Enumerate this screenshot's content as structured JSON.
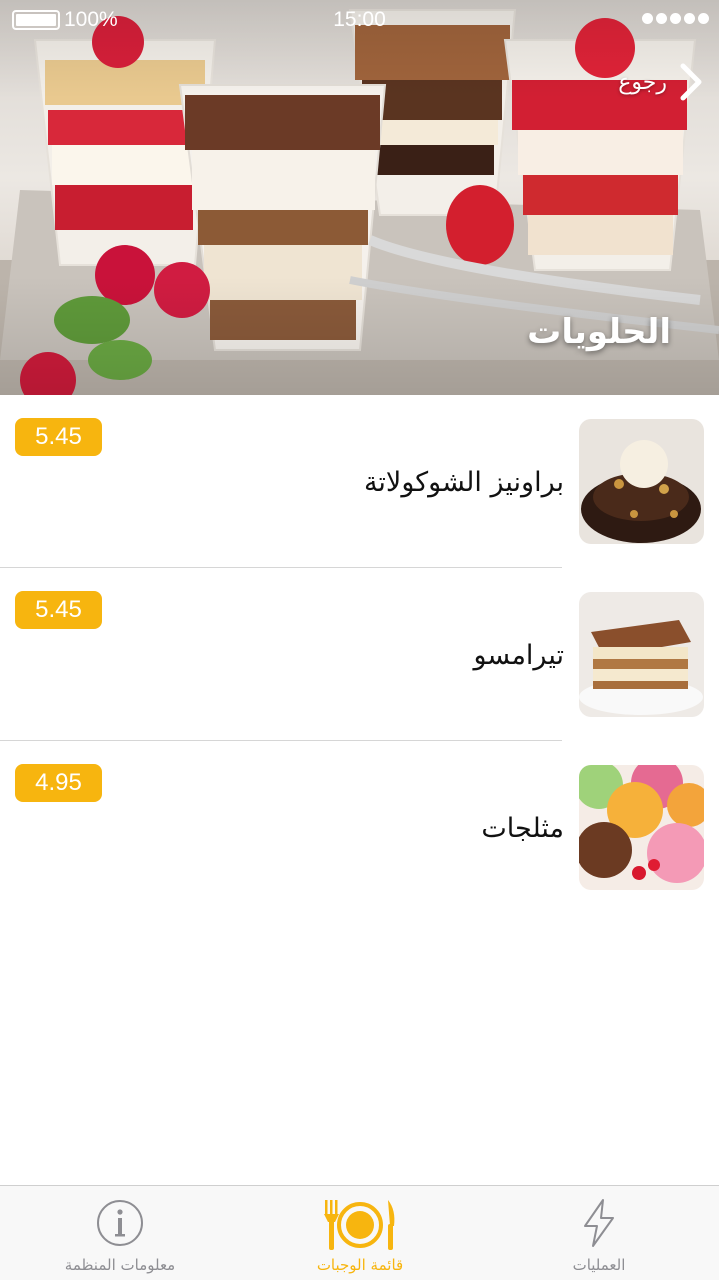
{
  "status_bar": {
    "battery": "100%",
    "time": "15:00",
    "signal_dots": 5
  },
  "header": {
    "back_label": "رجوع",
    "category_title": "الحلويات"
  },
  "menu": {
    "items": [
      {
        "name": "براونيز الشوكولاتة",
        "price": "5.45",
        "thumb_icon": "brownie-photo"
      },
      {
        "name": "تيرامسو",
        "price": "5.45",
        "thumb_icon": "tiramisu-photo"
      },
      {
        "name": "مثلجات",
        "price": "4.95",
        "thumb_icon": "ice-cream-photo"
      }
    ]
  },
  "tab_bar": {
    "tabs": [
      {
        "label": "معلومات المنظمة",
        "icon": "info-icon",
        "active": false
      },
      {
        "label": "قائمة الوجبات",
        "icon": "plate-cutlery-icon",
        "active": true
      },
      {
        "label": "العمليات",
        "icon": "lightning-icon",
        "active": false
      }
    ]
  },
  "colors": {
    "accent": "#f7b50f",
    "inactive_tab": "#8e8e93",
    "divider": "#d6d6d6"
  }
}
